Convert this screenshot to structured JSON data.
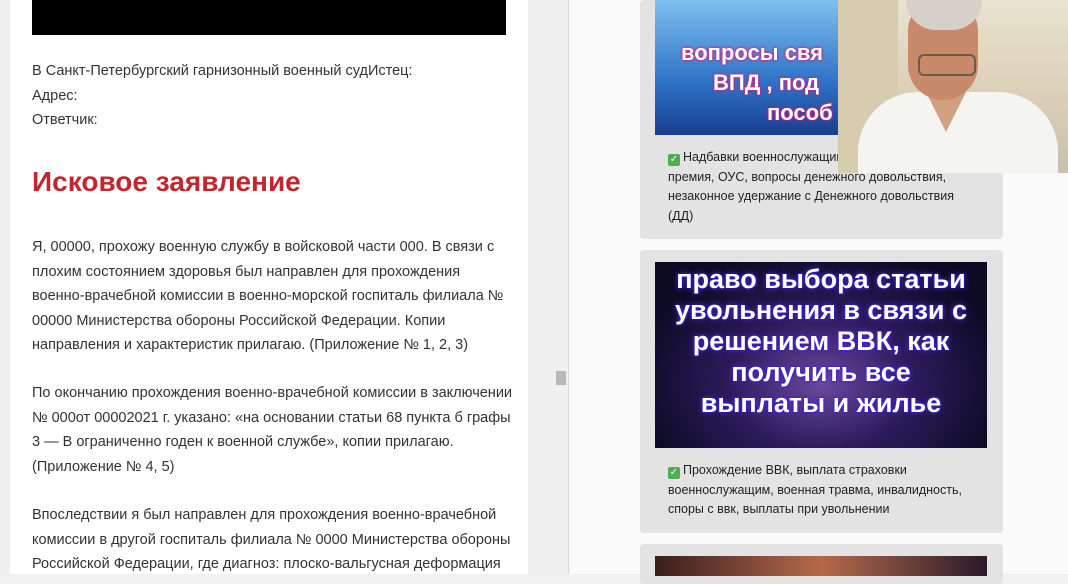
{
  "article": {
    "header_lines": [
      "В Санкт-Петербургский гарнизонный военный судИстец:",
      "Адрес:",
      "Ответчик:"
    ],
    "title": "Исковое заявление",
    "paragraphs": [
      "Я, 00000, прохожу военную службу в войсковой части 000. В связи с плохим состоянием здоровья был направлен для прохождения военно-врачебной комиссии в военно-морской госпиталь филиала № 00000 Министерства обороны Российской Федерации. Копии направления и характеристик прилагаю. (Приложение № 1, 2, 3)",
      "По окончанию прохождения военно-врачебной комиссии в заключении № 000от 00002021 г. указано: «на основании статьи 68 пункта б графы 3 — В ограниченно годен к военной службе», копии прилагаю. (Приложение № 4, 5)",
      "Впоследствии я был направлен для прохождения военно-врачебной комиссии в другой госпиталь филиала № 0000 Министерства обороны Российской Федерации, где диагноз: плоско-вальгусная деформация"
    ]
  },
  "sidebar": {
    "cards": [
      {
        "thumb_text": [
          "вопросы свя",
          "ВПД , под",
          "пособ"
        ],
        "desc": "Надбавки военнослужащим, премия, ОУС, вопросы денежного довольствия, незаконное удержание с Денежного довольствия (ДД)",
        "desc_lines": [
          "Надбавки военнослужащим,",
          "премия, ОУС, вопросы денежного довольствия,",
          "незаконное удержание с Денежного довольствия",
          "(ДД)"
        ]
      },
      {
        "thumb_text": [
          "право выбора статьи",
          "увольнения в связи с",
          "решением ВВК, как",
          "получить все",
          "выплаты и жилье"
        ],
        "desc_lines": [
          "Прохождение ВВК, выплата страховки",
          "военнослужащим, военная травма, инвалидность,",
          "споры с ввк, выплаты при увольнении"
        ]
      }
    ],
    "check_icon": "check-mark-icon",
    "check_color": "#4caf50"
  },
  "colors": {
    "title": "#c0282d",
    "text": "#333333"
  }
}
